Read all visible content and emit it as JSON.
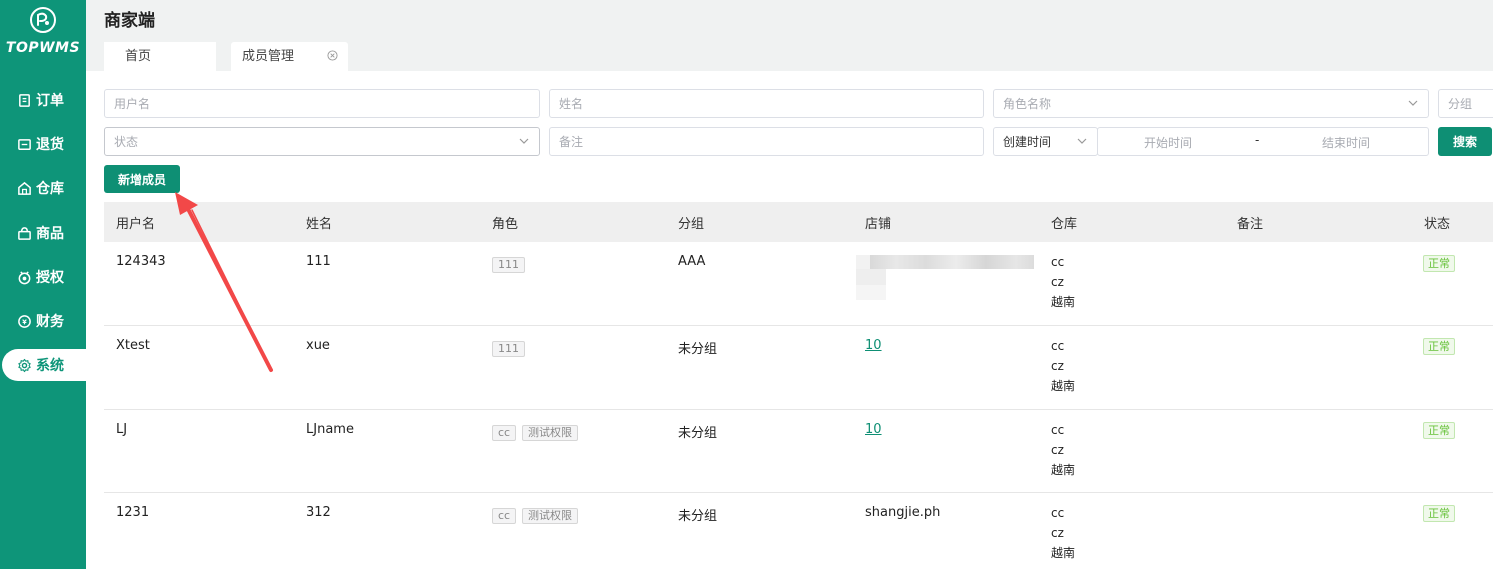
{
  "brand": {
    "logo_text": "TOPWMS",
    "title": "商家端"
  },
  "sidebar": {
    "items": [
      {
        "label": "订单",
        "icon": "clipboard-icon"
      },
      {
        "label": "退货",
        "icon": "return-box-icon"
      },
      {
        "label": "仓库",
        "icon": "warehouse-icon"
      },
      {
        "label": "商品",
        "icon": "bag-icon"
      },
      {
        "label": "授权",
        "icon": "authorize-icon"
      },
      {
        "label": "财务",
        "icon": "finance-icon"
      },
      {
        "label": "系统",
        "icon": "gear-icon",
        "active": true
      }
    ]
  },
  "tabs": [
    {
      "label": "首页"
    },
    {
      "label": "成员管理",
      "active": true
    }
  ],
  "filters": {
    "username_placeholder": "用户名",
    "name_placeholder": "姓名",
    "role_placeholder": "角色名称",
    "group_placeholder": "分组",
    "status_placeholder": "状态",
    "remark_placeholder": "备注",
    "time_type": "创建时间",
    "start_placeholder": "开始时间",
    "range_sep": "-",
    "end_placeholder": "结束时间",
    "search_label": "搜索"
  },
  "actions": {
    "add_member_label": "新增成员"
  },
  "table": {
    "columns": [
      "用户名",
      "姓名",
      "角色",
      "分组",
      "店铺",
      "仓库",
      "备注",
      "状态"
    ],
    "rows": [
      {
        "username": "124343",
        "name": "111",
        "roles": [
          "111"
        ],
        "group": "AAA",
        "store": "",
        "store_link": false,
        "warehouses": [
          "cc",
          "cz",
          "越南"
        ],
        "remark": "",
        "status": "正常"
      },
      {
        "username": "Xtest",
        "name": "xue",
        "roles": [
          "111"
        ],
        "group": "未分组",
        "store": "10",
        "store_link": true,
        "warehouses": [
          "cc",
          "cz",
          "越南"
        ],
        "remark": "",
        "status": "正常"
      },
      {
        "username": "LJ",
        "name": "LJname",
        "roles": [
          "cc",
          "测试权限"
        ],
        "group": "未分组",
        "store": "10",
        "store_link": true,
        "warehouses": [
          "cc",
          "cz",
          "越南"
        ],
        "remark": "",
        "status": "正常"
      },
      {
        "username": "1231",
        "name": "312",
        "roles": [
          "cc",
          "测试权限"
        ],
        "group": "未分组",
        "store": "shangjie.ph",
        "store_link": false,
        "warehouses": [
          "cc",
          "cz",
          "越南"
        ],
        "remark": "",
        "status": "正常"
      }
    ]
  },
  "colors": {
    "primary": "#0e9579",
    "button": "#0e8f74",
    "arrow": "#f24848"
  }
}
